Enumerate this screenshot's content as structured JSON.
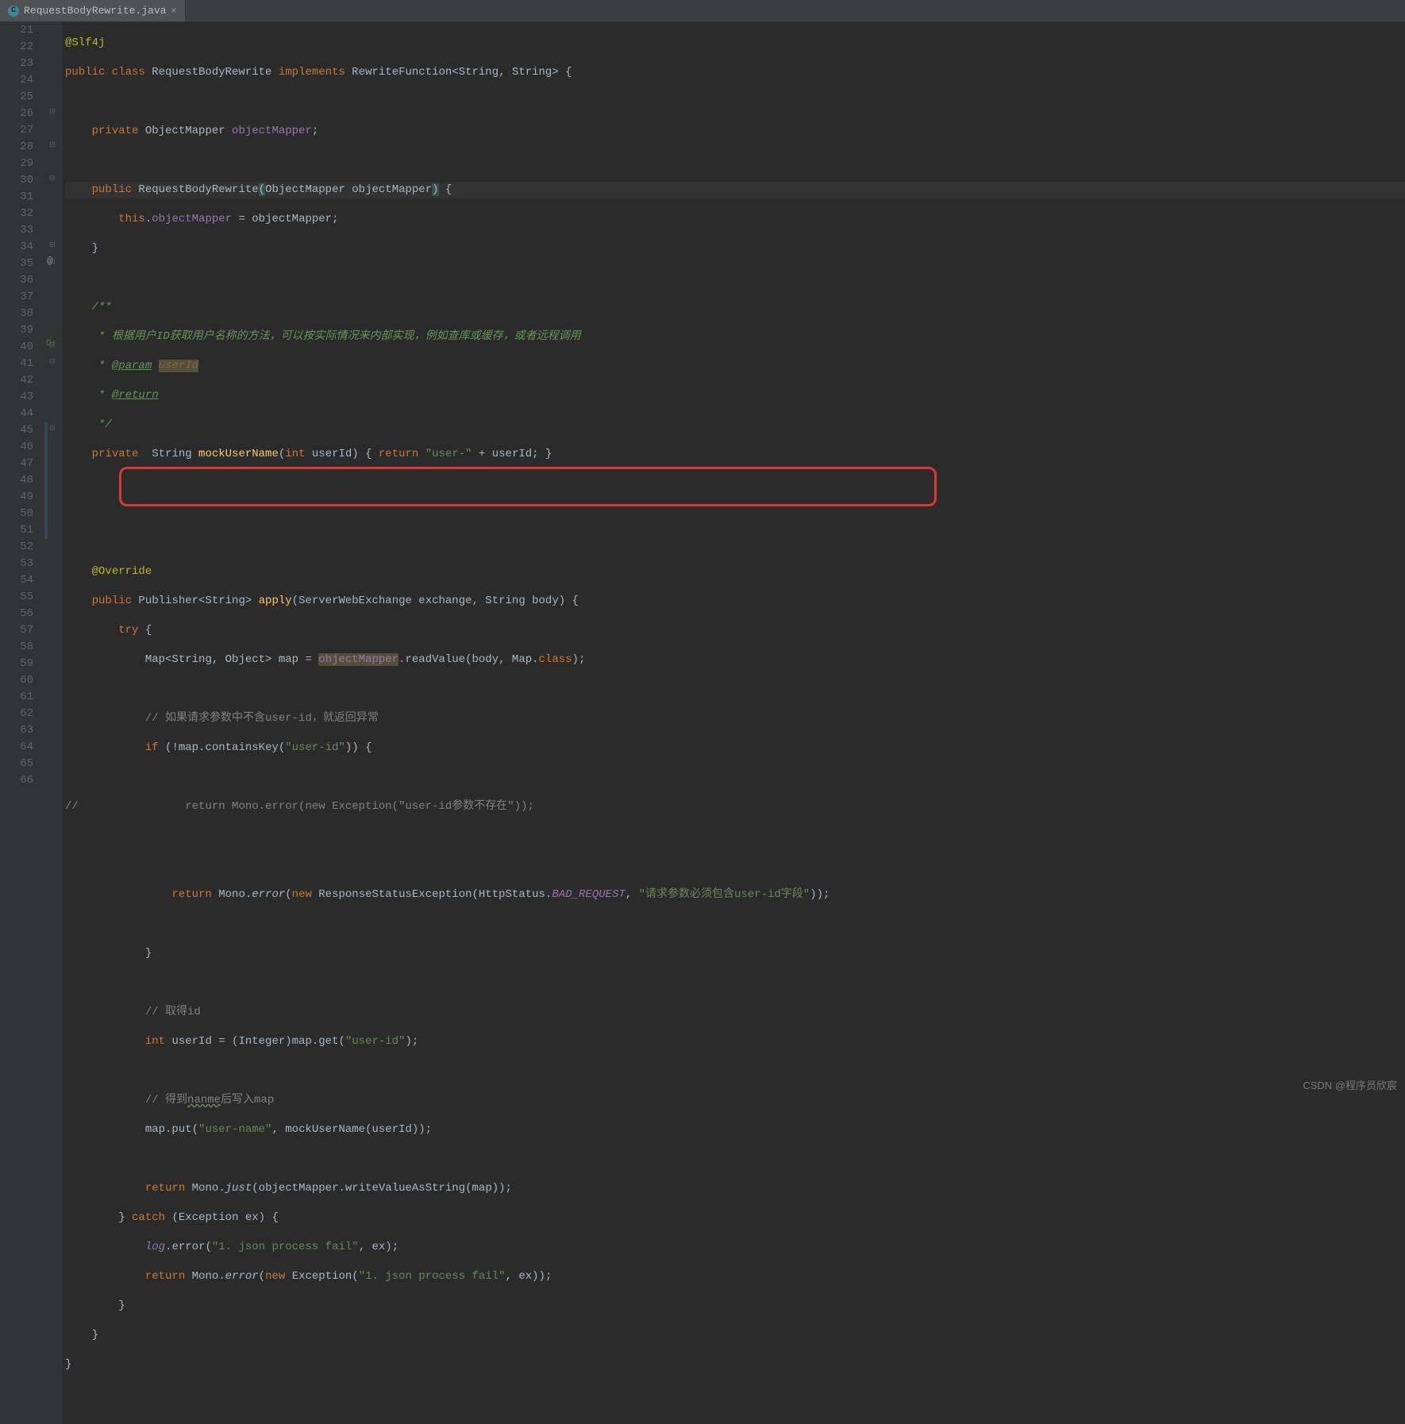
{
  "tab": {
    "icon_letter": "C",
    "filename": "RequestBodyRewrite.java",
    "close": "×"
  },
  "line_numbers": [
    "21",
    "22",
    "23",
    "24",
    "25",
    "26",
    "27",
    "28",
    "29",
    "30",
    "31",
    "32",
    "33",
    "34",
    "35",
    "36",
    "37",
    "38",
    "39",
    "40",
    "41",
    "42",
    "43",
    "44",
    "45",
    "46",
    "47",
    "48",
    "49",
    "50",
    "51",
    "52",
    "53",
    "54",
    "55",
    "56",
    "57",
    "58",
    "59",
    "60",
    "61",
    "62",
    "63",
    "64",
    "65",
    "66"
  ],
  "code": {
    "l21": "@Slf4j",
    "l22_a": "public class ",
    "l22_b": "RequestBodyRewrite ",
    "l22_c": "implements ",
    "l22_d": "RewriteFunction<String, String> {",
    "l24_a": "private ",
    "l24_b": "ObjectMapper ",
    "l24_c": "objectMapper",
    "l24_d": ";",
    "l26_a": "public ",
    "l26_b": "RequestBodyRewrite",
    "l26_c": "(",
    "l26_d": "ObjectMapper objectMapper",
    "l26_e": ")",
    "l26_f": " {",
    "l27_a": "this",
    "l27_b": ".",
    "l27_c": "objectMapper",
    "l27_d": " = objectMapper;",
    "l28": "}",
    "l30": "/**",
    "l31": " * 根据用户ID获取用户名称的方法，可以按实际情况来内部实现，例如查库或缓存，或者远程调用",
    "l32_a": " * ",
    "l32_b": "@param",
    "l32_c": " ",
    "l32_d": "userId",
    "l33_a": " * ",
    "l33_b": "@return",
    "l34": " */",
    "l35_a": "private  ",
    "l35_b": "String ",
    "l35_c": "mockUserName",
    "l35_d": "(",
    "l35_e": "int ",
    "l35_f": "userId) { ",
    "l35_g": "return ",
    "l35_h": "\"user-\"",
    "l35_i": " + userId; }",
    "l39": "@Override",
    "l40_a": "public ",
    "l40_b": "Publisher<String> ",
    "l40_c": "apply",
    "l40_d": "(ServerWebExchange exchange, String body) {",
    "l41_a": "try ",
    "l41_b": "{",
    "l42_a": "Map<String, Object> map = ",
    "l42_b": "objectMapper",
    "l42_c": ".readValue(body, Map.",
    "l42_d": "class",
    "l42_e": ");",
    "l44": "// 如果请求参数中不含user-id，就返回异常",
    "l45_a": "if ",
    "l45_b": "(!map.containsKey(",
    "l45_c": "\"user-id\"",
    "l45_d": ")) {",
    "l47_a": "//",
    "l47_b": "                return Mono.error(new Exception(\"user-id参数不存在\"));",
    "l50_a": "return ",
    "l50_b": "Mono.",
    "l50_c": "error",
    "l50_d": "(",
    "l50_e": "new ",
    "l50_f": "ResponseStatusException(HttpStatus.",
    "l50_g": "BAD_REQUEST",
    "l50_h": ", ",
    "l50_i": "\"请求参数必须包含user-id字段\"",
    "l50_j": "));",
    "l52": "}",
    "l54": "// 取得id",
    "l55_a": "int ",
    "l55_b": "userId = (Integer)map.get(",
    "l55_c": "\"user-id\"",
    "l55_d": ");",
    "l57_a": "// 得到",
    "l57_b": "nanme",
    "l57_c": "后写入map",
    "l58_a": "map.put(",
    "l58_b": "\"user-name\"",
    "l58_c": ", mockUserName(userId));",
    "l60_a": "return ",
    "l60_b": "Mono.",
    "l60_c": "just",
    "l60_d": "(objectMapper.writeValueAsString(map));",
    "l61_a": "} ",
    "l61_b": "catch ",
    "l61_c": "(Exception ex) {",
    "l62_a": "log",
    "l62_b": ".error(",
    "l62_c": "\"1. json process fail\"",
    "l62_d": ", ex);",
    "l63_a": "return ",
    "l63_b": "Mono.",
    "l63_c": "error",
    "l63_d": "(",
    "l63_e": "new ",
    "l63_f": "Exception(",
    "l63_g": "\"1. json process fail\"",
    "l63_h": ", ex));",
    "l64": "}",
    "l65": "}",
    "l66": "}"
  },
  "watermark": "CSDN @程序员欣宸"
}
